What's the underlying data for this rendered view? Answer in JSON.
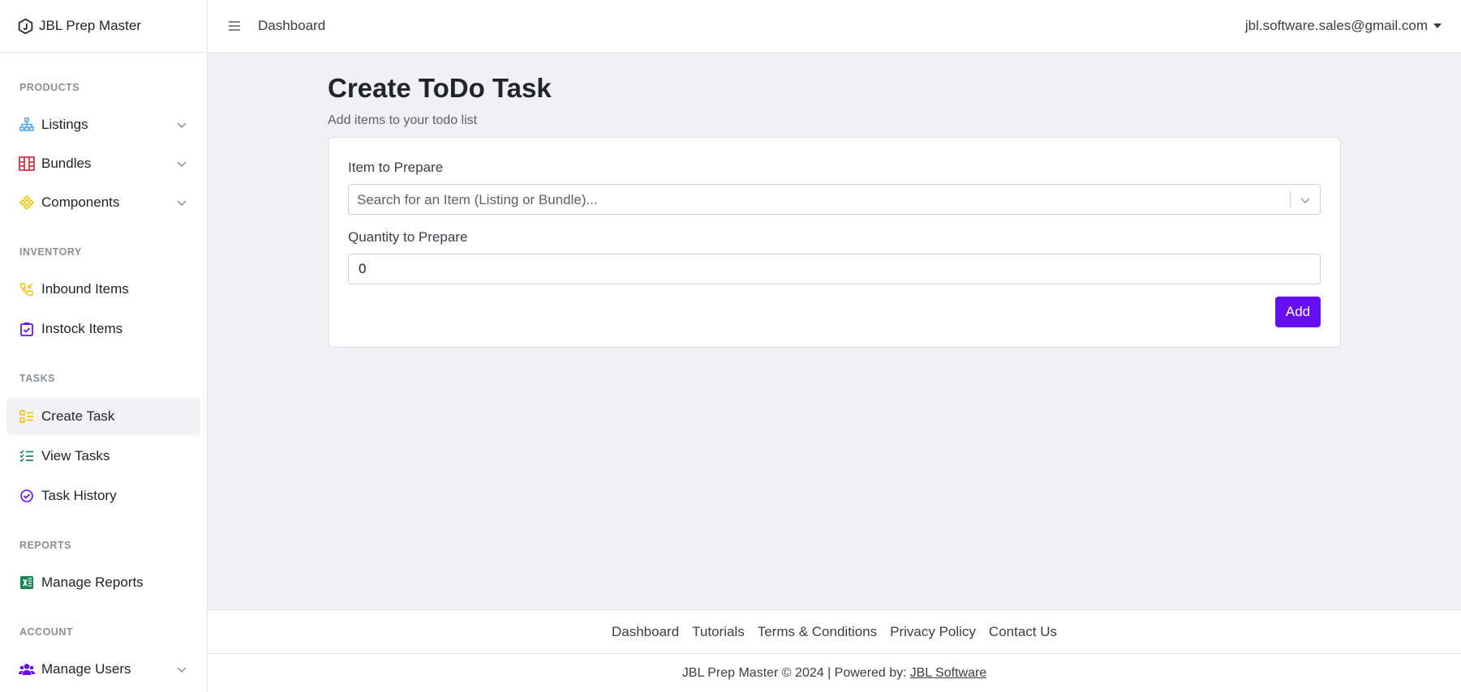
{
  "brand": {
    "name": "JBL Prep Master",
    "icon": "hexagon-j-logo"
  },
  "header": {
    "title": "Dashboard",
    "user_email": "jbl.software.sales@gmail.com"
  },
  "sidebar": {
    "sections": [
      {
        "title": "PRODUCTS"
      },
      {
        "title": "INVENTORY"
      },
      {
        "title": "TASKS"
      },
      {
        "title": "REPORTS"
      },
      {
        "title": "ACCOUNT"
      }
    ],
    "items": [
      {
        "label": "Listings",
        "icon": "sitemap-icon",
        "color": "#4aa3df"
      },
      {
        "label": "Bundles",
        "icon": "grid-boxes-icon",
        "color": "#dc3545"
      },
      {
        "label": "Components",
        "icon": "diamond-cluster-icon",
        "color": "#f2c200"
      },
      {
        "label": "Inbound Items",
        "icon": "inbound-phone-icon",
        "color": "#f2c200"
      },
      {
        "label": "Instock Items",
        "icon": "clipboard-check-icon",
        "color": "#6610f2"
      },
      {
        "label": "Create Task",
        "icon": "checklist-icon",
        "color": "#f2c200"
      },
      {
        "label": "View Tasks",
        "icon": "list-check-icon",
        "color": "#198754"
      },
      {
        "label": "Task History",
        "icon": "circle-check-icon",
        "color": "#6610f2"
      },
      {
        "label": "Manage Reports",
        "icon": "excel-icon",
        "color": "#198754"
      },
      {
        "label": "Manage Users",
        "icon": "users-icon",
        "color": "#6610f2"
      }
    ]
  },
  "main": {
    "title": "Create ToDo Task",
    "subtitle": "Add items to your todo list",
    "item_label": "Item to Prepare",
    "item_placeholder": "Search for an Item (Listing or Bundle)...",
    "quantity_label": "Quantity to Prepare",
    "quantity_value": "0",
    "add_label": "Add",
    "accent_color": "#6610f2"
  },
  "footer": {
    "links": [
      "Dashboard",
      "Tutorials",
      "Terms & Conditions",
      "Privacy Policy",
      "Contact Us"
    ],
    "copyright": "JBL Prep Master © 2024 | Powered by:",
    "powered_by_link": "JBL Software"
  }
}
